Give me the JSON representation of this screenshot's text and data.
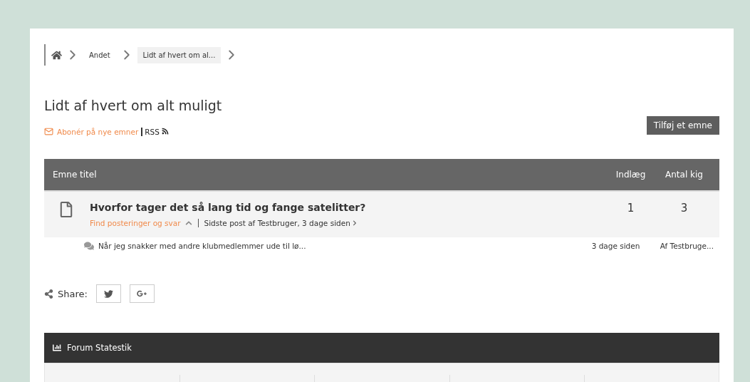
{
  "breadcrumb": [
    {
      "label": "Andet",
      "selected": false
    },
    {
      "label": "Lidt af hvert om al...",
      "selected": true
    }
  ],
  "title": "Lidt af hvert om alt muligt",
  "subscribe": "Abonér på nye emner",
  "rss": "RSS",
  "add_button": "Tilføj et emne",
  "table": {
    "columns": [
      "Emne titel",
      "Indlæg",
      "Antal kig"
    ],
    "rows": [
      {
        "title": "Hvorfor tager det så lang tid og fange satelitter?",
        "find": "Find posteringer og svar",
        "last_post": "Sidste post af Testbruger, 3 dage siden",
        "posts": "1",
        "views": "3",
        "expanded": true,
        "replies": [
          {
            "text": "Når jeg snakker med andre klubmedlemmer ude til lø...",
            "time": "3 dage siden",
            "author": "Af Testbruge..."
          }
        ]
      }
    ]
  },
  "share": {
    "label": "Share:"
  },
  "stats": {
    "title": "Forum Statestik"
  }
}
